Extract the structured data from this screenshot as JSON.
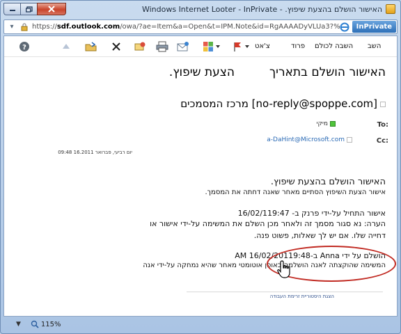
{
  "window": {
    "title": "האישור הושלם בהצעת שיפוץ. - Windows Internet Looter - InPrivate"
  },
  "address": {
    "inprivate_label": "InPrivate",
    "url_prefix": "https://",
    "url_host": "sdf.outlook.com",
    "url_rest": "/owa/?ae=Item&a=Open&t=IPM.Note&id=RgAAAADyVLUa3?%2bVIBdMVB"
  },
  "toolbar": {
    "reply_label": "השב",
    "reply_all_label": "השבה לכולם",
    "forward_label": "פרוד",
    "chat_label": "צ'אט"
  },
  "message": {
    "subject_part1": "האישור הושלם בתאריך",
    "subject_part2": "הצעת שיפוץ.",
    "sender": "[no-reply@spoppe.com] מרכז המסמכים",
    "to_label": "To:",
    "to_value": "מיקי",
    "cc_label": "Cc:",
    "cc_value": "a-DaHint@Microsoft.com",
    "date": "יום רביעי, פברואר 16.2011 09:48"
  },
  "body": {
    "heading": "האישור הושלם בהצעת שיפוץ.",
    "line1": "אישור הצעת השיפוץ הסתיים מאחר שאנה דחתה את המסמך.",
    "line2": "אישור התחיל על-ידי פרנק ב- 16/02/119:47",
    "line3": "הערה: נא סגור מסמך זה ולאחר מכן השלם את המשימה על-ידי אישור או",
    "line4": "דחייה שלו. אם יש לך שאלות, פשוט פנה.",
    "line5": "הושלם על ידי Anna ב-16/02/20119:48 AM",
    "line6": "המשימה שהוקצתה לאנה הושלמה באופן אוטומטי מאחר שהיא נמחקה על-ידי אנה",
    "history_link": "הצגת היסטוריית זרימת העבודה"
  },
  "status": {
    "zoom": "115%"
  },
  "colors": {
    "highlight_ring": "#c12a22",
    "inprivate_bg": "#2c6fb8",
    "link": "#2a6ab5"
  }
}
